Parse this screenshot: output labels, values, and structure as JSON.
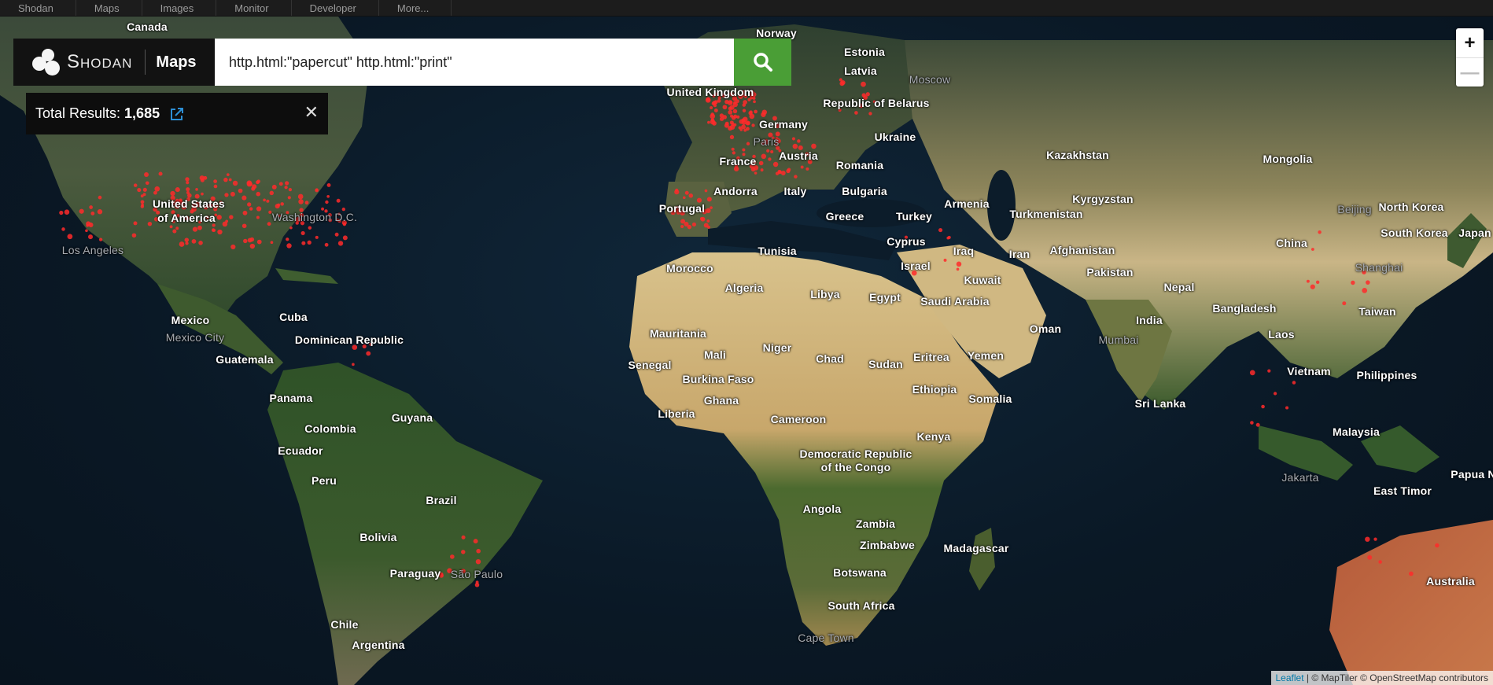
{
  "nav": {
    "items": [
      "Shodan",
      "Maps",
      "Images",
      "Monitor",
      "Developer",
      "More..."
    ]
  },
  "brand": {
    "logo_text": "Shodan",
    "section_label": "Maps"
  },
  "search": {
    "value": "http.html:\"papercut\" http.html:\"print\"",
    "button_icon": "search-icon"
  },
  "results": {
    "label": "Total Results:",
    "count": "1,685",
    "external_icon": "external-link-icon",
    "close_icon": "close-icon"
  },
  "zoom": {
    "in": "+",
    "out": "—"
  },
  "attribution": {
    "leaflet": "Leaflet",
    "rest": "| © MapTiler © OpenStreetMap contributors"
  },
  "colors": {
    "accent": "#4a9e36",
    "marker": "#ff2a2a",
    "panel": "#121212"
  },
  "map": {
    "labels": {
      "canada": "Canada",
      "norway": "Norway",
      "estonia": "Estonia",
      "latvia": "Latvia",
      "moscow": "Moscow",
      "uk": "United Kingdom",
      "belarus": "Republic of Belarus",
      "germany": "Germany",
      "ukraine": "Ukraine",
      "kazakhstan": "Kazakhstan",
      "mongolia": "Mongolia",
      "paris": "Paris",
      "austria": "Austria",
      "france": "France",
      "romania": "Romania",
      "andorra": "Andorra",
      "italy": "Italy",
      "bulgaria": "Bulgaria",
      "armenia": "Armenia",
      "kyrgyzstan": "Kyrgyzstan",
      "turkmenistan": "Turkmenistan",
      "beijing": "Beijing",
      "north_korea": "North Korea",
      "south_korea": "South Korea",
      "japan": "Japan",
      "usa": "United States",
      "usa2": "of America",
      "washington": "Washington D.C.",
      "portugal": "Portugal",
      "greece": "Greece",
      "turkey": "Turkey",
      "cyprus": "Cyprus",
      "iraq": "Iraq",
      "iran": "Iran",
      "afghanistan": "Afghanistan",
      "china": "China",
      "los_angeles": "Los Angeles",
      "tunisia": "Tunisia",
      "israel": "Israel",
      "kuwait": "Kuwait",
      "pakistan": "Pakistan",
      "shanghai": "Shanghai",
      "morocco": "Morocco",
      "algeria": "Algeria",
      "libya": "Libya",
      "egypt": "Egypt",
      "saudi": "Saudi Arabia",
      "nepal": "Nepal",
      "bangladesh": "Bangladesh",
      "taiwan": "Taiwan",
      "mexico": "Mexico",
      "cuba": "Cuba",
      "india": "India",
      "oman": "Oman",
      "laos": "Laos",
      "mexico_city": "Mexico City",
      "dominican": "Dominican Republic",
      "mauritania": "Mauritania",
      "mumbai": "Mumbai",
      "guatemala": "Guatemala",
      "mali": "Mali",
      "niger": "Niger",
      "chad": "Chad",
      "sudan": "Sudan",
      "eritrea": "Eritrea",
      "yemen": "Yemen",
      "senegal": "Senegal",
      "vietnam": "Vietnam",
      "philippines": "Philippines",
      "burkina": "Burkina Faso",
      "ethiopia": "Ethiopia",
      "panama": "Panama",
      "ghana": "Ghana",
      "somalia": "Somalia",
      "sri_lanka": "Sri Lanka",
      "liberia": "Liberia",
      "guyana": "Guyana",
      "cameroon": "Cameroon",
      "colombia": "Colombia",
      "malaysia": "Malaysia",
      "kenya": "Kenya",
      "ecuador": "Ecuador",
      "drc1": "Democratic Republic",
      "drc2": "of the Congo",
      "papua": "Papua N",
      "peru": "Peru",
      "jakarta": "Jakarta",
      "east_timor": "East Timor",
      "brazil": "Brazil",
      "angola": "Angola",
      "zambia": "Zambia",
      "bolivia": "Bolivia",
      "zimbabwe": "Zimbabwe",
      "madagascar": "Madagascar",
      "paraguay": "Paraguay",
      "sao_paulo": "São Paulo",
      "botswana": "Botswana",
      "australia": "Australia",
      "south_africa": "South Africa",
      "chile": "Chile",
      "cape_town": "Cape Town",
      "argentina": "Argentina"
    }
  }
}
